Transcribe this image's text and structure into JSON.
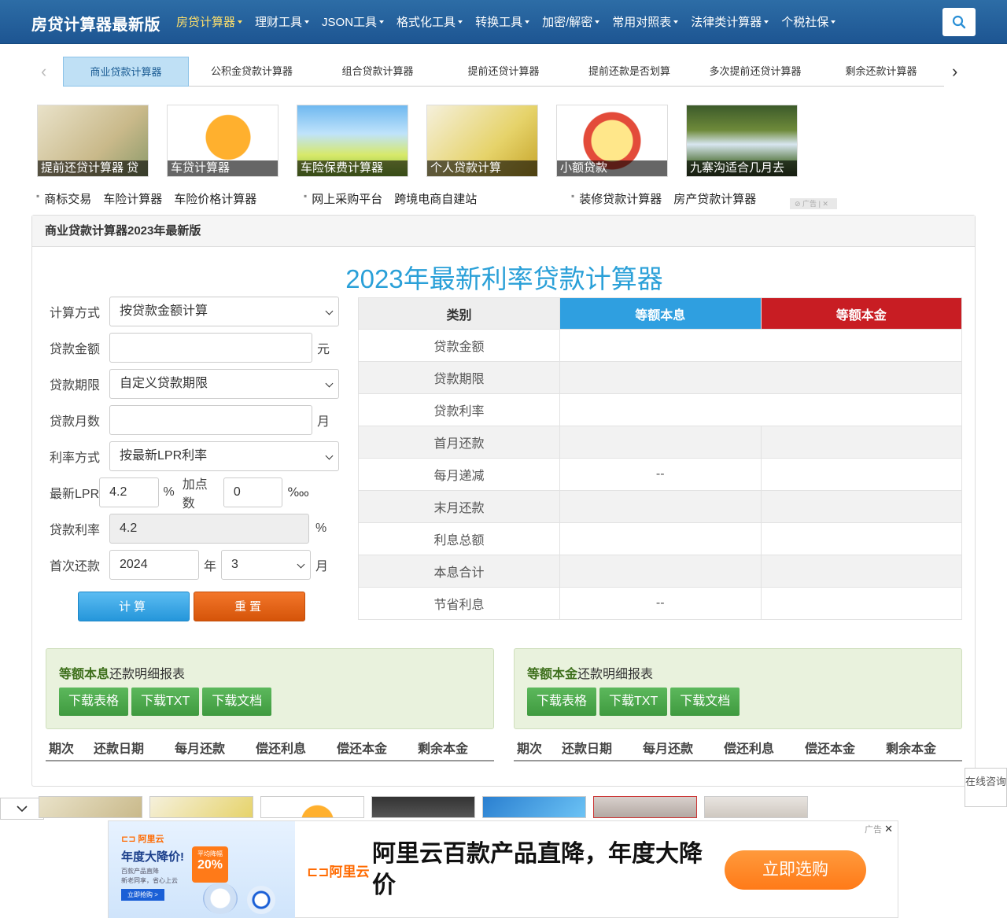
{
  "brand": "房贷计算器最新版",
  "nav": [
    {
      "label": "房贷计算器",
      "active": true
    },
    {
      "label": "理财工具"
    },
    {
      "label": "JSON工具"
    },
    {
      "label": "格式化工具"
    },
    {
      "label": "转换工具"
    },
    {
      "label": "加密/解密"
    },
    {
      "label": "常用对照表"
    },
    {
      "label": "法律类计算器"
    },
    {
      "label": "个税社保"
    }
  ],
  "tabs": [
    "商业贷款计算器",
    "公积金贷款计算器",
    "组合贷款计算器",
    "提前还贷计算器",
    "提前还款是否划算",
    "多次提前还贷计算器",
    "剩余还款计算器"
  ],
  "image_ads": [
    "提前还贷计算器 贷",
    "车贷计算器",
    "车险保费计算器",
    "个人贷款计算",
    "小额贷款",
    "九寨沟适合几月去"
  ],
  "link_groups": [
    [
      "商标交易",
      "车险计算器",
      "车险价格计算器"
    ],
    [
      "网上采购平台",
      "跨境电商自建站"
    ],
    [
      "装修贷款计算器",
      "房产贷款计算器"
    ]
  ],
  "ad_label": "广告",
  "panel_title": "商业贷款计算器2023年最新版",
  "calc_title": "2023年最新利率贷款计算器",
  "form": {
    "calc_method_label": "计算方式",
    "calc_method_value": "按贷款金额计算",
    "amount_label": "贷款金额",
    "amount_unit": "元",
    "term_label": "贷款期限",
    "term_value": "自定义贷款期限",
    "months_label": "贷款月数",
    "months_unit": "月",
    "rate_method_label": "利率方式",
    "rate_method_value": "按最新LPR利率",
    "lpr_label": "最新LPR",
    "lpr_value": "4.2",
    "lpr_unit": "%",
    "bp_label": "加点数",
    "bp_value": "0",
    "bp_unit": "‱",
    "rate_label": "贷款利率",
    "rate_value": "4.2",
    "rate_unit": "%",
    "first_label": "首次还款",
    "first_year": "2024",
    "year_unit": "年",
    "first_month": "3",
    "month_unit": "月"
  },
  "buttons": {
    "calc": "计算",
    "reset": "重置"
  },
  "table": {
    "headers": [
      "类别",
      "等额本息",
      "等额本金"
    ],
    "rows": [
      {
        "label": "贷款金额",
        "merged": true,
        "a": ""
      },
      {
        "label": "贷款期限",
        "merged": true,
        "a": ""
      },
      {
        "label": "贷款利率",
        "merged": true,
        "a": ""
      },
      {
        "label": "首月还款",
        "a": "",
        "b": ""
      },
      {
        "label": "每月递减",
        "a": "--",
        "b": ""
      },
      {
        "label": "末月还款",
        "a": "",
        "b": ""
      },
      {
        "label": "利息总额",
        "a": "",
        "b": ""
      },
      {
        "label": "本息合计",
        "a": "",
        "b": ""
      },
      {
        "label": "节省利息",
        "a": "--",
        "b": ""
      }
    ]
  },
  "reports": [
    {
      "strong": "等额本息",
      "rest": "还款明细报表"
    },
    {
      "strong": "等额本金",
      "rest": "还款明细报表"
    }
  ],
  "report_buttons": [
    "下载表格",
    "下载TXT",
    "下载文档"
  ],
  "detail_headers": [
    "期次",
    "还款日期",
    "每月还款",
    "偿还利息",
    "偿还本金",
    "剩余本金"
  ],
  "consult": "在线咨询",
  "bottom_ad": {
    "tag": "广告",
    "brand": "阿里云",
    "promo_title": "年度大降价!",
    "promo_badge_top": "平均降幅",
    "promo_badge": "20%",
    "promo_sub": "百款产品直降",
    "promo_sub2": "新老同享，省心上云",
    "promo_btn": "立即抢购 >",
    "headline": "阿里云百款产品直降，年度大降价",
    "cta": "立即选购"
  }
}
